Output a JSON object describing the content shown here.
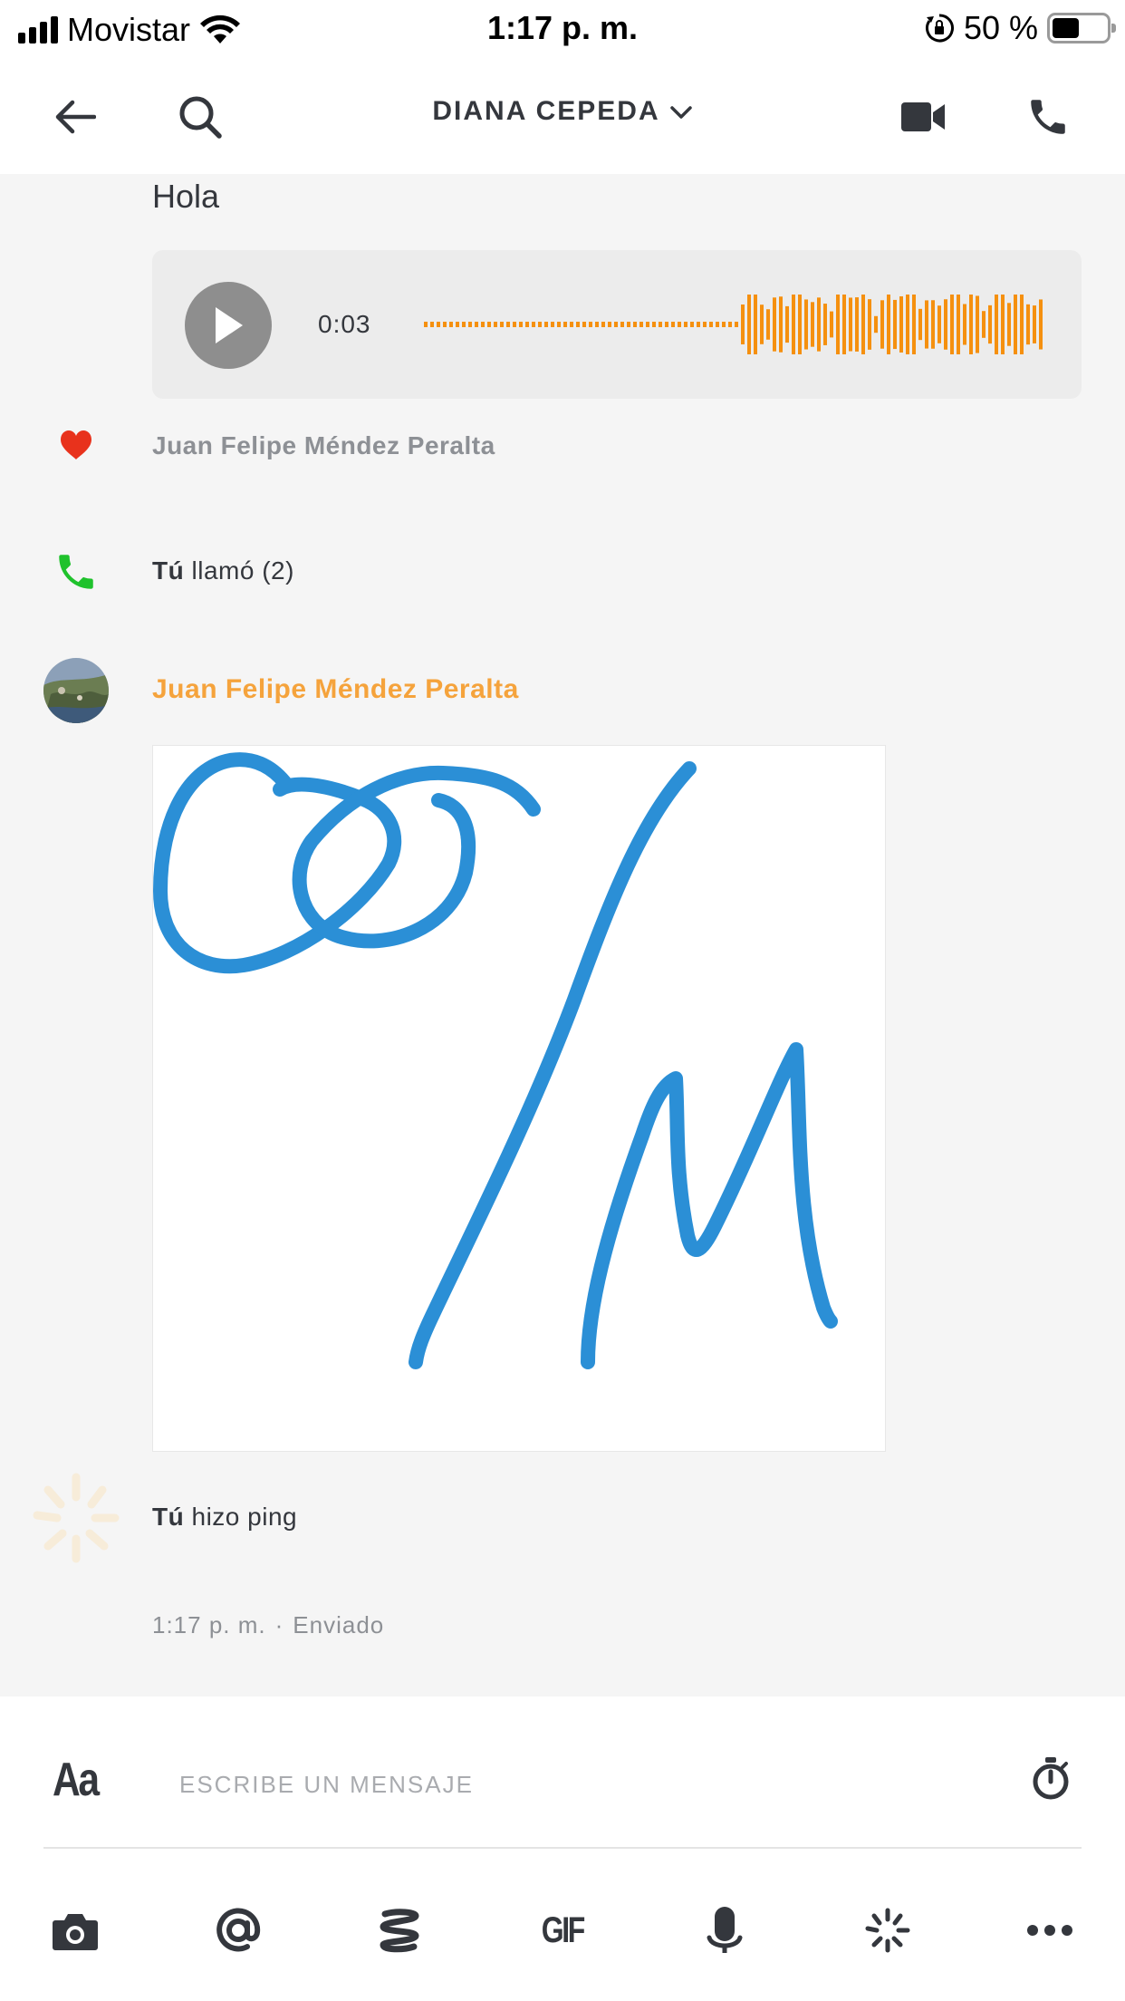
{
  "status_bar": {
    "carrier": "Movistar",
    "time": "1:17 p. m.",
    "battery": "50 %",
    "battery_level": 0.5
  },
  "header": {
    "title": "DIANA CEPEDA"
  },
  "messages": {
    "text_message": "Hola",
    "audio": {
      "duration": "0:03",
      "color": "#f5900f"
    },
    "like": {
      "name": "Juan Felipe Méndez Peralta",
      "icon": "heart-icon",
      "color": "#e8321c"
    },
    "call": {
      "actor": "Tú",
      "text": "llamó (2)",
      "icon": "phone-icon",
      "color": "#1fc22c"
    },
    "sender": {
      "name": "Juan Felipe Méndez Peralta",
      "color": "#f5a33c"
    },
    "drawing": {
      "stroke_color": "#2b8fd6"
    },
    "ping": {
      "actor": "Tú",
      "text": "hizo ping"
    },
    "meta": {
      "time": "1:17 p. m.",
      "separator": "·",
      "status": "Enviado"
    }
  },
  "composer": {
    "format_label": "Aa",
    "placeholder": "ESCRIBE UN MENSAJE",
    "toolbar": [
      "camera-icon",
      "mention-icon",
      "sketch-icon",
      "gif-button",
      "microphone-icon",
      "ping-icon",
      "more-icon"
    ],
    "gif_label": "GIF"
  }
}
